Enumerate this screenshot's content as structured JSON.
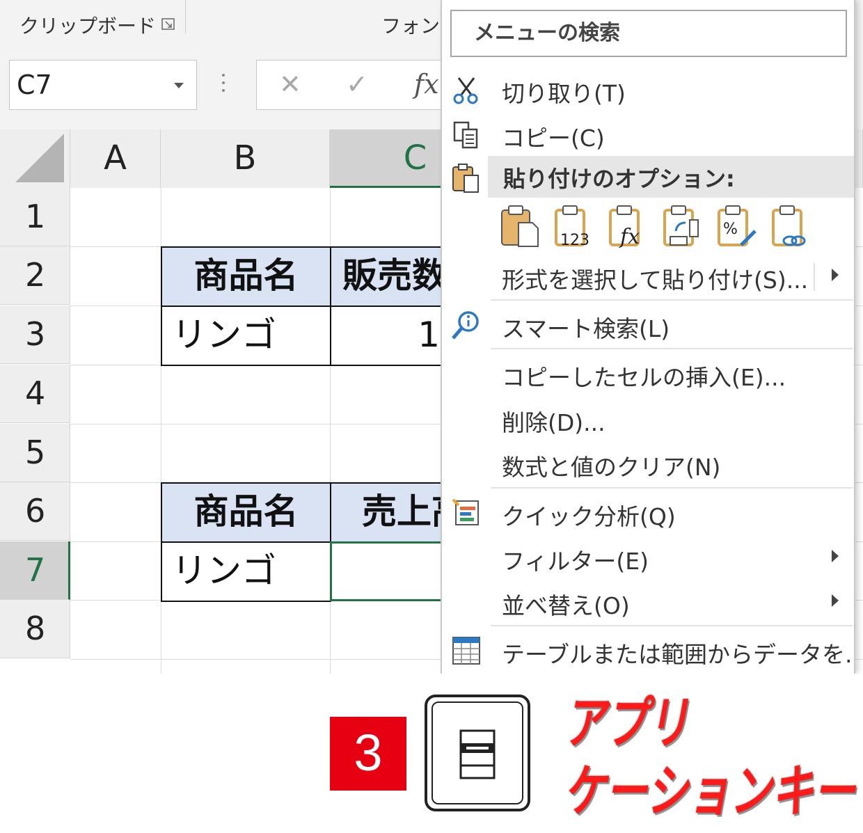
{
  "ribbon": {
    "clipboard_label": "クリップボード",
    "font_label": "フォント"
  },
  "formula_bar": {
    "name_box": "C7",
    "cancel_icon": "✕",
    "enter_icon": "✓",
    "fx_label": "fx"
  },
  "columns": [
    "A",
    "B",
    "C"
  ],
  "rows": [
    "1",
    "2",
    "3",
    "4",
    "5",
    "6",
    "7",
    "8"
  ],
  "cells": {
    "b2": "商品名",
    "c2": "販売数",
    "b3": "リンゴ",
    "c3": "1",
    "b6": "商品名",
    "c6": "売上高",
    "b7": "リンゴ"
  },
  "context_menu": {
    "search_placeholder": "メニューの検索",
    "items": {
      "cut": "切り取り(T)",
      "copy": "コピー(C)",
      "paste_options": "貼り付けのオプション:",
      "paste_special": "形式を選択して貼り付け(S)...",
      "smart_lookup": "スマート検索(L)",
      "insert_copied": "コピーしたセルの挿入(E)...",
      "delete": "削除(D)...",
      "clear": "数式と値のクリア(N)",
      "quick_analysis": "クイック分析(Q)",
      "filter": "フィルター(E)",
      "sort": "並べ替え(O)",
      "table_range": "テーブルまたは範囲からデータを..."
    },
    "paste_value_label": "123",
    "paste_formula_label": "fx",
    "paste_percent_label": "%"
  },
  "annotation": {
    "step": "3",
    "line1": "アプリ",
    "line2": "ケーションキー"
  },
  "colors": {
    "excel_green": "#217346",
    "header_fill": "#dae3f3",
    "badge_red": "#e60012",
    "label_red": "#ff1a1a"
  }
}
